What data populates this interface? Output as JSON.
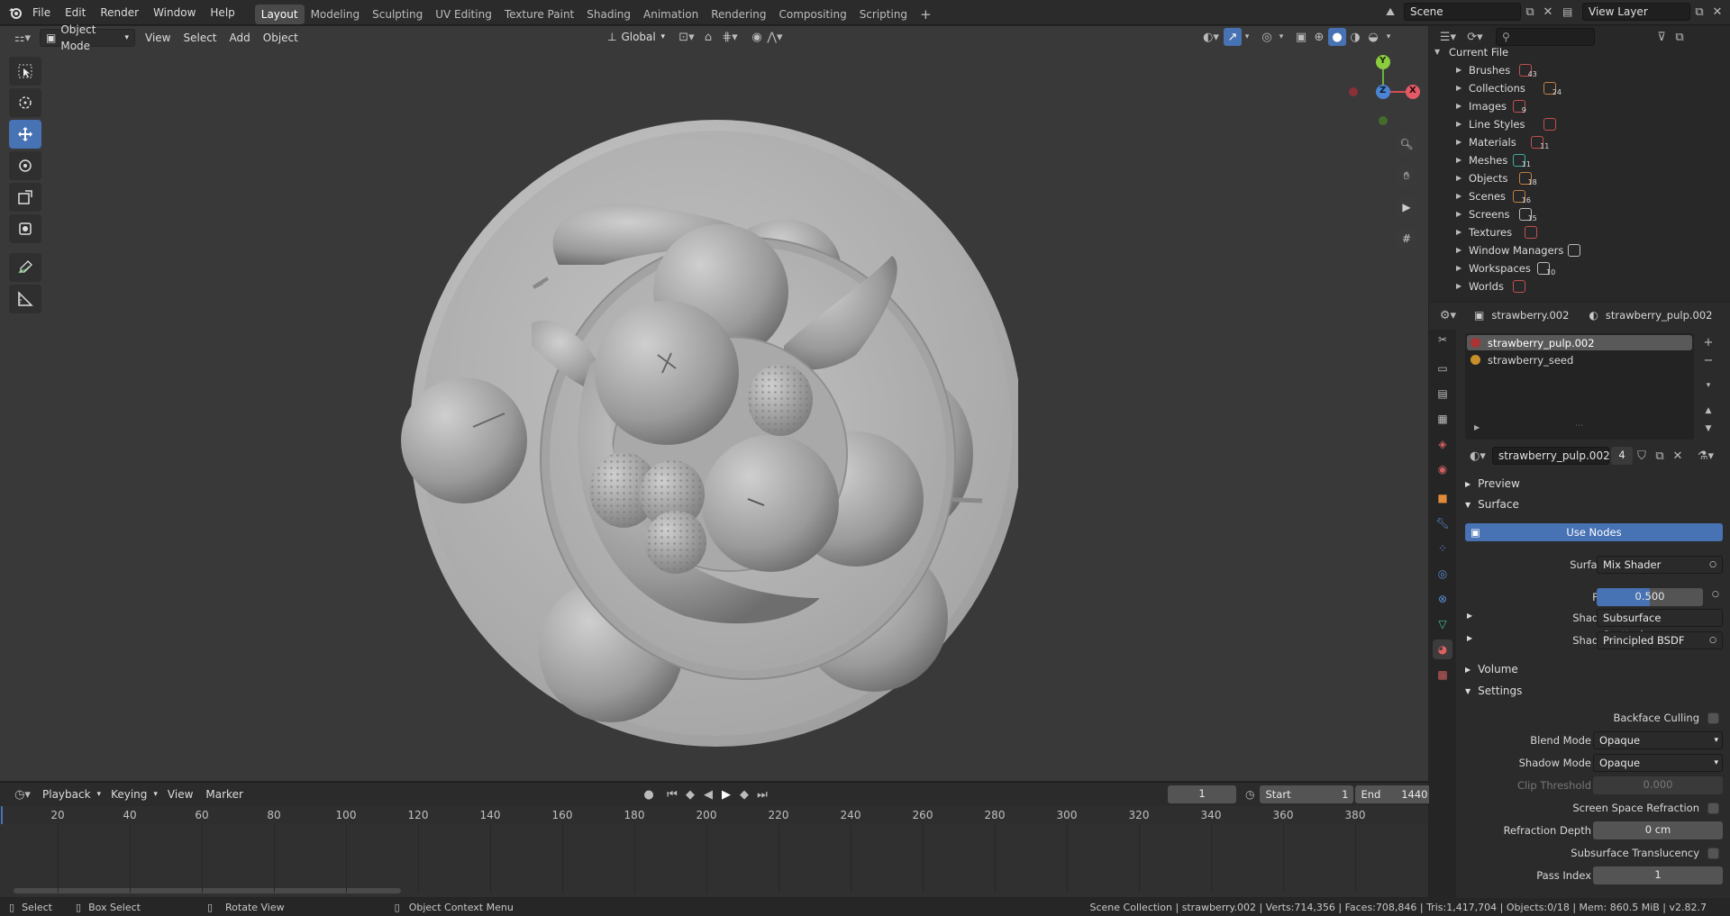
{
  "topbar": {
    "menus": [
      "File",
      "Edit",
      "Render",
      "Window",
      "Help"
    ],
    "workspaces": [
      "Layout",
      "Modeling",
      "Sculpting",
      "UV Editing",
      "Texture Paint",
      "Shading",
      "Animation",
      "Rendering",
      "Compositing",
      "Scripting"
    ],
    "active_workspace": "Layout",
    "add_tab": "+",
    "scene": "Scene",
    "view_layer": "View Layer"
  },
  "viewport": {
    "mode": "Object Mode",
    "menus": [
      "View",
      "Select",
      "Add",
      "Object"
    ],
    "orientation": "Global",
    "gizmo": {
      "x": "X",
      "y": "Y",
      "z": "Z"
    }
  },
  "timeline": {
    "menus": [
      "Playback",
      "Keying",
      "View",
      "Marker"
    ],
    "current_frame": "1",
    "start_label": "Start",
    "start": "1",
    "end_label": "End",
    "end": "1440",
    "ticks": [
      "20",
      "40",
      "60",
      "80",
      "100",
      "120",
      "140",
      "160",
      "180",
      "200",
      "220",
      "240",
      "260",
      "280",
      "300",
      "320",
      "340",
      "360",
      "380"
    ]
  },
  "statusbar": {
    "select": "Select",
    "box_select": "Box Select",
    "rotate": "Rotate View",
    "context": "Object Context Menu",
    "stats": "Scene Collection | strawberry.002 | Verts:714,356 | Faces:708,846 | Tris:1,417,704 | Objects:0/18 | Mem: 860.5 MiB | v2.82.7"
  },
  "outliner": {
    "root": "Current File",
    "items": [
      {
        "label": "Brushes",
        "count": "43",
        "color": "#c05050"
      },
      {
        "label": "Collections",
        "count": "24",
        "color": "#c08040"
      },
      {
        "label": "Images",
        "count": "9",
        "color": "#c05050"
      },
      {
        "label": "Line Styles",
        "count": "",
        "color": "#c05050"
      },
      {
        "label": "Materials",
        "count": "11",
        "color": "#c05050"
      },
      {
        "label": "Meshes",
        "count": "11",
        "color": "#40b0a0"
      },
      {
        "label": "Objects",
        "count": "18",
        "color": "#c08040"
      },
      {
        "label": "Scenes",
        "count": "16",
        "color": "#c08040"
      },
      {
        "label": "Screens",
        "count": "15",
        "color": "#bbbbbb"
      },
      {
        "label": "Textures",
        "count": "",
        "color": "#c05050"
      },
      {
        "label": "Window Managers",
        "count": "",
        "color": "#bbbbbb"
      },
      {
        "label": "Workspaces",
        "count": "10",
        "color": "#bbbbbb"
      },
      {
        "label": "Worlds",
        "count": "",
        "color": "#c05050"
      }
    ]
  },
  "properties": {
    "object": "strawberry.002",
    "material": "strawberry_pulp.002",
    "slots": [
      "strawberry_pulp.002",
      "strawberry_seed"
    ],
    "material_name": "strawberry_pulp.002",
    "users": "4",
    "panels": {
      "preview": "Preview",
      "surface": "Surface",
      "volume": "Volume",
      "settings": "Settings"
    },
    "use_nodes": "Use Nodes",
    "surface_label": "Surface",
    "surface_value": "Mix Shader",
    "fac_label": "Fac",
    "fac_value": "0.500",
    "fac_fraction": 0.5,
    "shader1_label": "Shader",
    "shader1_value": "Subsurface Scattering",
    "shader2_label": "Shader",
    "shader2_value": "Principled BSDF",
    "backface_culling": "Backface Culling",
    "blend_mode_label": "Blend Mode",
    "blend_mode": "Opaque",
    "shadow_mode_label": "Shadow Mode",
    "shadow_mode": "Opaque",
    "clip_label": "Clip Threshold",
    "clip_value": "0.000",
    "ssr": "Screen Space Refraction",
    "refraction_depth_label": "Refraction Depth",
    "refraction_depth": "0 cm",
    "sss_translucency": "Subsurface Translucency",
    "pass_index_label": "Pass Index",
    "pass_index": "1"
  }
}
